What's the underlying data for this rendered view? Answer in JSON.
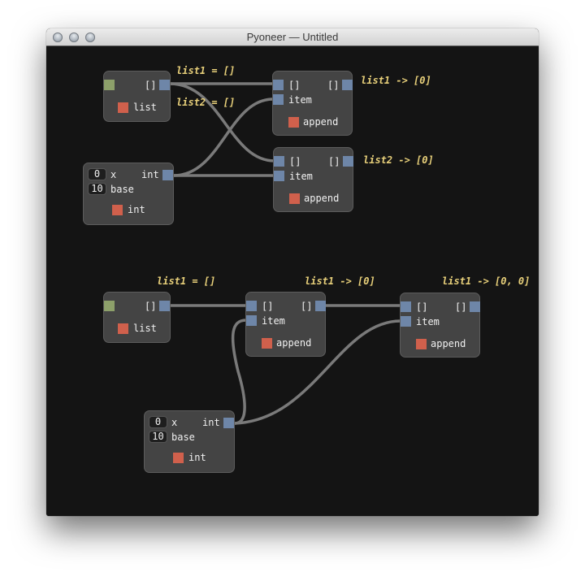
{
  "window": {
    "title": "Pyoneer — Untitled"
  },
  "colors": {
    "canvas": "#141414",
    "node": "#444444",
    "port": "#6e86a8",
    "trigger": "#d0604c",
    "source_port": "#8da06a",
    "wire": "#7a7a7a",
    "annotation": "#e8d07a"
  },
  "graph1": {
    "list_node": {
      "out_label": "[]",
      "trigger_label": "list"
    },
    "int_node": {
      "x_value": "0",
      "x_label": "x",
      "base_value": "10",
      "base_label": "base",
      "out_label": "int",
      "trigger_label": "int"
    },
    "append1": {
      "in_list_label": "[]",
      "out_label": "[]",
      "item_label": "item",
      "trigger_label": "append"
    },
    "append2": {
      "in_list_label": "[]",
      "out_label": "[]",
      "item_label": "item",
      "trigger_label": "append"
    },
    "annotations": {
      "list1_assign": "list1 = []",
      "list2_assign": "list2 = []",
      "list1_result": "list1 -> [0]",
      "list2_result": "list2 -> [0]"
    }
  },
  "graph2": {
    "list_node": {
      "out_label": "[]",
      "trigger_label": "list"
    },
    "int_node": {
      "x_value": "0",
      "x_label": "x",
      "base_value": "10",
      "base_label": "base",
      "out_label": "int",
      "trigger_label": "int"
    },
    "append1": {
      "in_list_label": "[]",
      "out_label": "[]",
      "item_label": "item",
      "trigger_label": "append"
    },
    "append2": {
      "in_list_label": "[]",
      "out_label": "[]",
      "item_label": "item",
      "trigger_label": "append"
    },
    "annotations": {
      "list1_assign": "list1 = []",
      "list1_result1": "list1 -> [0]",
      "list1_result2": "list1 -> [0, 0]"
    }
  }
}
